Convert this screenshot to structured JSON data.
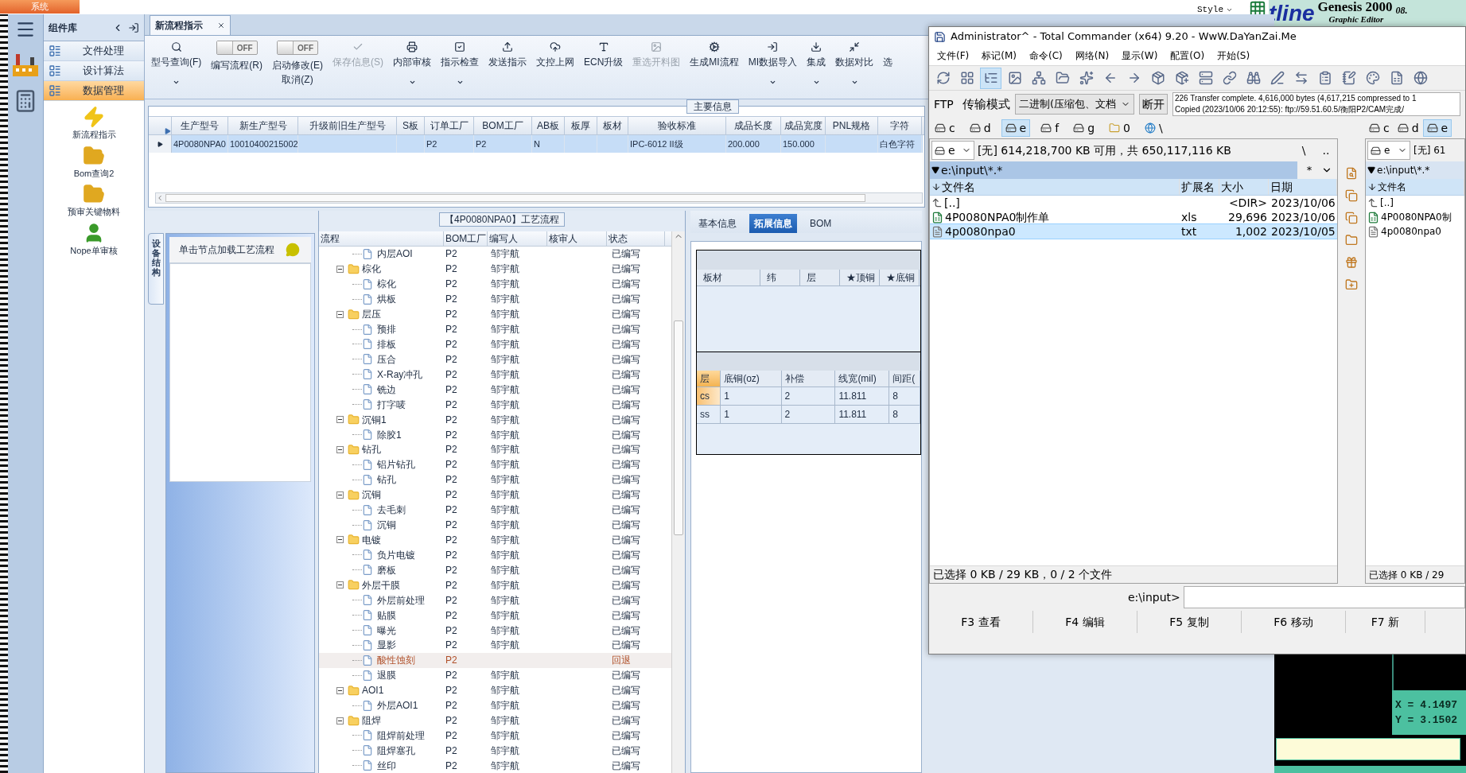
{
  "top_strip": {
    "system_tab": "系统"
  },
  "genesis": {
    "style_label": "Style",
    "logo_text": "tline",
    "product": "Genesis 2000",
    "version": "08.",
    "subtitle": "Graphic Editor",
    "coord_x": "X = 4.1497",
    "coord_y": "Y = 3.1502"
  },
  "app": {
    "sidebar": {
      "title": "组件库",
      "categories": [
        {
          "label": "文件处理",
          "selected": false
        },
        {
          "label": "设计算法",
          "selected": false
        },
        {
          "label": "数据管理",
          "selected": true
        }
      ],
      "shortcuts": [
        {
          "label": "新流程指示"
        },
        {
          "label": "Bom查询2"
        },
        {
          "label": "预审关键物料"
        },
        {
          "label": "Nope单审核"
        }
      ]
    },
    "tabs": [
      {
        "label": "新流程指示",
        "selected": true
      }
    ],
    "toolbar": [
      {
        "kind": "button",
        "label": "型号查询(F)",
        "caret": true,
        "disabled": false
      },
      {
        "kind": "toggle",
        "label": "编写流程(R)",
        "on": false,
        "state_text": "OFF"
      },
      {
        "kind": "toggle",
        "label": "启动修改(E)",
        "sublabel": "取消(Z)",
        "on": false,
        "state_text": "OFF"
      },
      {
        "kind": "button",
        "label": "保存信息(S)",
        "caret": false,
        "disabled": true
      },
      {
        "kind": "button",
        "label": "内部审核",
        "caret": true,
        "disabled": false
      },
      {
        "kind": "button",
        "label": "指示检查",
        "caret": true,
        "disabled": false
      },
      {
        "kind": "button",
        "label": "发送指示",
        "caret": false,
        "disabled": false
      },
      {
        "kind": "button",
        "label": "文控上网",
        "caret": false,
        "disabled": false
      },
      {
        "kind": "button",
        "label": "ECN升级",
        "caret": false,
        "disabled": false
      },
      {
        "kind": "button",
        "label": "重选开料图",
        "caret": false,
        "disabled": true
      },
      {
        "kind": "button",
        "label": "生成MI流程",
        "caret": false,
        "disabled": false
      },
      {
        "kind": "button",
        "label": "MI数据导入",
        "caret": true,
        "disabled": false
      },
      {
        "kind": "button",
        "label": "集成",
        "caret": true,
        "disabled": false
      },
      {
        "kind": "button",
        "label": "数据对比",
        "caret": true,
        "disabled": false
      },
      {
        "kind": "button",
        "label": "选",
        "caret": false,
        "disabled": false
      }
    ],
    "main_info": {
      "title": "主要信息",
      "columns": [
        "生产型号",
        "新生产型号",
        "升级前旧生产型号",
        "S板",
        "订单工厂",
        "BOM工厂",
        "AB板",
        "板厚",
        "板材",
        "验收标准",
        "成品长度",
        "成品宽度",
        "PNL规格",
        "字符"
      ],
      "rows": [
        {
          "selected": true,
          "cells": [
            "4P0080NPA0",
            "10010400215002",
            null,
            null,
            "P2",
            "P2",
            "N",
            null,
            null,
            "IPC-6012 II级",
            "200.000",
            "150.000",
            null,
            "白色字符"
          ]
        }
      ]
    },
    "structure_panel": {
      "vertical_tab": "设备结构",
      "hint": "单击节点加载工艺流程"
    },
    "process": {
      "title": "【4P0080NPA0】工艺流程",
      "columns": [
        "流程",
        "BOM工厂",
        "编写人",
        "核审人",
        "状态"
      ],
      "tree": [
        {
          "children": [
            {
              "name": "内层AOI",
              "bom": "P2",
              "writer": "邹宇航",
              "status": "已编写",
              "returned": false
            }
          ]
        },
        {
          "name": "棕化",
          "bom": "P2",
          "writer": "邹宇航",
          "status": "已编写",
          "returned": false,
          "expanded": true,
          "children": [
            {
              "name": "棕化",
              "bom": "P2",
              "writer": "邹宇航",
              "status": "已编写",
              "returned": false
            },
            {
              "name": "烘板",
              "bom": "P2",
              "writer": "邹宇航",
              "status": "已编写",
              "returned": false
            }
          ]
        },
        {
          "name": "层压",
          "bom": "P2",
          "writer": "邹宇航",
          "status": "已编写",
          "returned": false,
          "expanded": true,
          "children": [
            {
              "name": "预排",
              "bom": "P2",
              "writer": "邹宇航",
              "status": "已编写",
              "returned": false
            },
            {
              "name": "排板",
              "bom": "P2",
              "writer": "邹宇航",
              "status": "已编写",
              "returned": false
            },
            {
              "name": "压合",
              "bom": "P2",
              "writer": "邹宇航",
              "status": "已编写",
              "returned": false
            },
            {
              "name": "X-Ray冲孔",
              "bom": "P2",
              "writer": "邹宇航",
              "status": "已编写",
              "returned": false
            },
            {
              "name": "铣边",
              "bom": "P2",
              "writer": "邹宇航",
              "status": "已编写",
              "returned": false
            },
            {
              "name": "打字唛",
              "bom": "P2",
              "writer": "邹宇航",
              "status": "已编写",
              "returned": false
            }
          ]
        },
        {
          "name": "沉铜1",
          "bom": "P2",
          "writer": "邹宇航",
          "status": "已编写",
          "returned": false,
          "expanded": true,
          "children": [
            {
              "name": "除胶1",
              "bom": "P2",
              "writer": "邹宇航",
              "status": "已编写",
              "returned": false
            }
          ]
        },
        {
          "name": "钻孔",
          "bom": "P2",
          "writer": "邹宇航",
          "status": "已编写",
          "returned": false,
          "expanded": true,
          "children": [
            {
              "name": "铝片钻孔",
              "bom": "P2",
              "writer": "邹宇航",
              "status": "已编写",
              "returned": false
            },
            {
              "name": "钻孔",
              "bom": "P2",
              "writer": "邹宇航",
              "status": "已编写",
              "returned": false
            }
          ]
        },
        {
          "name": "沉铜",
          "bom": "P2",
          "writer": "邹宇航",
          "status": "已编写",
          "returned": false,
          "expanded": true,
          "children": [
            {
              "name": "去毛刺",
              "bom": "P2",
              "writer": "邹宇航",
              "status": "已编写",
              "returned": false
            },
            {
              "name": "沉铜",
              "bom": "P2",
              "writer": "邹宇航",
              "status": "已编写",
              "returned": false
            }
          ]
        },
        {
          "name": "电镀",
          "bom": "P2",
          "writer": "邹宇航",
          "status": "已编写",
          "returned": false,
          "expanded": true,
          "children": [
            {
              "name": "负片电镀",
              "bom": "P2",
              "writer": "邹宇航",
              "status": "已编写",
              "returned": false
            },
            {
              "name": "磨板",
              "bom": "P2",
              "writer": "邹宇航",
              "status": "已编写",
              "returned": false
            }
          ]
        },
        {
          "name": "外层干膜",
          "bom": "P2",
          "writer": "邹宇航",
          "status": "已编写",
          "returned": false,
          "expanded": true,
          "children": [
            {
              "name": "外层前处理",
              "bom": "P2",
              "writer": "邹宇航",
              "status": "已编写",
              "returned": false
            },
            {
              "name": "贴膜",
              "bom": "P2",
              "writer": "邹宇航",
              "status": "已编写",
              "returned": false
            },
            {
              "name": "曝光",
              "bom": "P2",
              "writer": "邹宇航",
              "status": "已编写",
              "returned": false
            },
            {
              "name": "显影",
              "bom": "P2",
              "writer": "邹宇航",
              "status": "已编写",
              "returned": false
            },
            {
              "name": "酸性蚀刻",
              "bom": "P2",
              "status": "回退",
              "returned": true
            },
            {
              "name": "退膜",
              "bom": "P2",
              "writer": "邹宇航",
              "status": "已编写",
              "returned": false
            }
          ]
        },
        {
          "name": "AOI1",
          "bom": "P2",
          "writer": "邹宇航",
          "status": "已编写",
          "returned": false,
          "expanded": true,
          "children": [
            {
              "name": "外层AOI1",
              "bom": "P2",
              "writer": "邹宇航",
              "status": "已编写",
              "returned": false
            }
          ]
        },
        {
          "name": "阻焊",
          "bom": "P2",
          "writer": "邹宇航",
          "status": "已编写",
          "returned": false,
          "expanded": true,
          "children": [
            {
              "name": "阻焊前处理",
              "bom": "P2",
              "writer": "邹宇航",
              "status": "已编写",
              "returned": false
            },
            {
              "name": "阻焊塞孔",
              "bom": "P2",
              "writer": "邹宇航",
              "status": "已编写",
              "returned": false
            },
            {
              "name": "丝印",
              "bom": "P2",
              "writer": "邹宇航",
              "status": "已编写",
              "returned": false
            }
          ]
        }
      ]
    },
    "detail": {
      "tabs": [
        {
          "label": "基本信息",
          "selected": false
        },
        {
          "label": "拓展信息",
          "selected": true
        },
        {
          "label": "BOM",
          "selected": false
        }
      ],
      "material_table": {
        "columns": [
          "板材",
          "纬",
          "层",
          "★顶铜",
          "★底铜"
        ]
      },
      "copper_table": {
        "columns": [
          "层",
          "底铜(oz)",
          "补偿",
          "线宽(mil)",
          "间距("
        ],
        "rows": [
          {
            "selected": true,
            "cells": [
              "cs",
              "1",
              "2",
              "11.811",
              "8"
            ]
          },
          {
            "selected": false,
            "cells": [
              "ss",
              "1",
              "2",
              "11.811",
              "8"
            ]
          }
        ]
      }
    }
  },
  "tc": {
    "title": "Administrator^ - Total Commander (x64) 9.20 - WwW.DaYanZai.Me",
    "menu": [
      "文件(F)",
      "标记(M)",
      "命令(C)",
      "网络(N)",
      "显示(W)",
      "配置(O)",
      "开始(S)"
    ],
    "toolbar": [
      {
        "selected": false
      },
      {
        "selected": false
      },
      {
        "selected": true
      },
      {
        "selected": false
      },
      {
        "selected": false
      },
      {
        "selected": false
      },
      {
        "selected": false
      },
      {
        "selected": false
      },
      {
        "selected": false
      },
      {
        "selected": false
      },
      {
        "selected": false
      },
      {
        "selected": false
      },
      {
        "selected": false
      },
      {
        "selected": false
      },
      {
        "selected": false
      },
      {
        "selected": false
      },
      {
        "selected": false
      },
      {
        "selected": false
      },
      {
        "selected": false
      },
      {
        "selected": false
      },
      {
        "selected": false
      }
    ],
    "ftp": {
      "label": "FTP",
      "mode_label": "传输模式",
      "mode_value": "二进制(压缩包、文档",
      "disconnect": "断开",
      "log": [
        "226 Transfer complete. 4,616,000 bytes (4,617,215 compressed to 1",
        "Copied (2023/10/06 20:12:55): ftp://59.51.60.5/衡阳P2/CAM完成/"
      ]
    },
    "left_drives": [
      {
        "kind": "drive",
        "label": "c",
        "selected": false
      },
      {
        "kind": "drive",
        "label": "d",
        "selected": false
      },
      {
        "kind": "drive",
        "label": "e",
        "selected": true
      },
      {
        "kind": "drive",
        "label": "f",
        "selected": false
      },
      {
        "kind": "drive",
        "label": "g",
        "selected": false
      },
      {
        "kind": "folder",
        "label": "0",
        "selected": false
      },
      {
        "kind": "network",
        "label": "\\",
        "selected": false
      }
    ],
    "right_drives": [
      {
        "kind": "drive",
        "label": "c",
        "selected": false
      },
      {
        "kind": "drive",
        "label": "d",
        "selected": false
      },
      {
        "kind": "drive",
        "label": "e",
        "selected": true
      }
    ],
    "left_panel": {
      "drive": "e",
      "free_space": "[无] 614,218,700 KB 可用，共 650,117,116 KB",
      "root": "\\",
      "up": "..",
      "path": "e:\\input\\*.*",
      "filter": "*",
      "active": true,
      "columns": [
        "文件名",
        "扩展名",
        "大小",
        "日期"
      ],
      "files": [
        {
          "kind": "up",
          "name": "[..]",
          "size": "<DIR>",
          "date": "2023/10/06",
          "selected": false
        },
        {
          "kind": "sheet",
          "name": "4P0080NPA0制作单",
          "ext": "xls",
          "size": "29,696",
          "date": "2023/10/06",
          "selected": false
        },
        {
          "kind": "text",
          "name": "4p0080npa0",
          "ext": "txt",
          "size": "1,002",
          "date": "2023/10/05",
          "selected": true
        }
      ],
      "status": "已选择 0 KB / 29 KB，0 / 2 个文件"
    },
    "right_panel": {
      "drive": "e",
      "free_space": "[无] 61",
      "path": "e:\\input\\*.*",
      "active": false,
      "columns": [
        "文件名"
      ],
      "files": [
        {
          "kind": "up",
          "name": "[..]",
          "selected": false
        },
        {
          "kind": "sheet",
          "name": "4P0080NPA0制",
          "selected": false
        },
        {
          "kind": "text",
          "name": "4p0080npa0",
          "selected": false
        }
      ],
      "status": "已选择 0 KB / 29"
    },
    "command_prompt": "e:\\input>",
    "function_keys": [
      "F3 查看",
      "F4 编辑",
      "F5 复制",
      "F6 移动",
      "F7 新"
    ]
  }
}
